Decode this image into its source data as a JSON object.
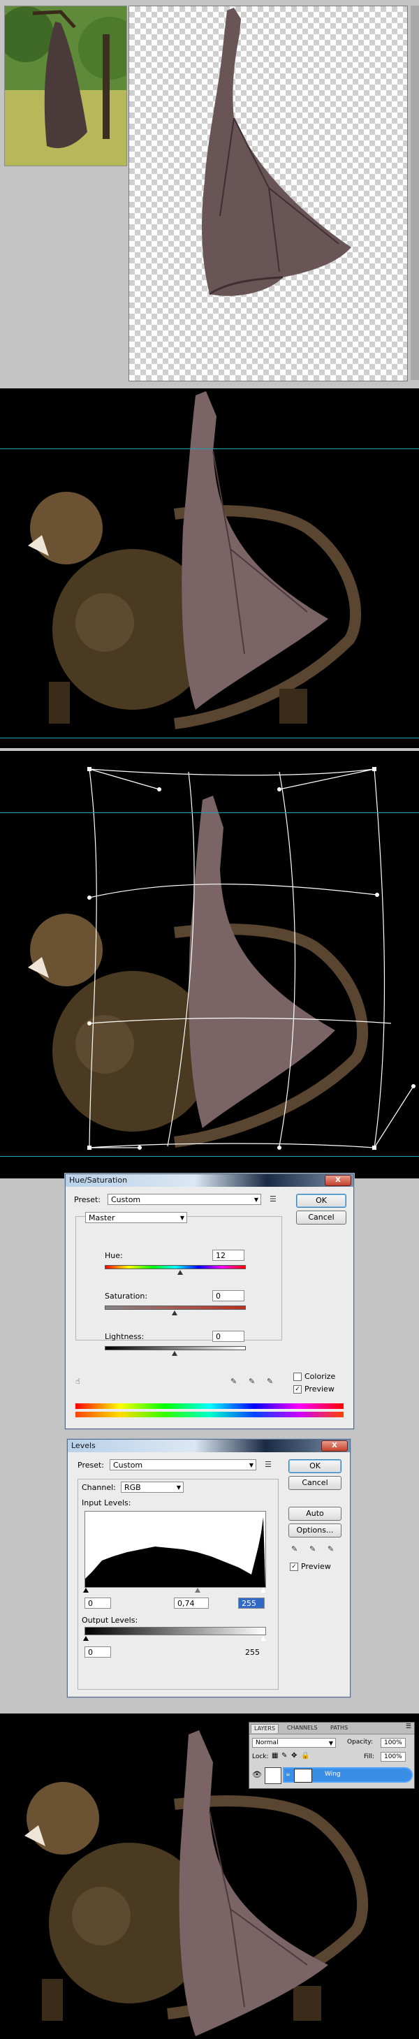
{
  "hue_saturation": {
    "title": "Hue/Saturation",
    "close": "X",
    "preset_label": "Preset:",
    "preset_value": "Custom",
    "channel_value": "Master",
    "hue_label": "Hue:",
    "hue_value": "12",
    "saturation_label": "Saturation:",
    "saturation_value": "0",
    "lightness_label": "Lightness:",
    "lightness_value": "0",
    "ok": "OK",
    "cancel": "Cancel",
    "colorize_label": "Colorize",
    "preview_label": "Preview",
    "preview_checked": "✓"
  },
  "levels": {
    "title": "Levels",
    "close": "X",
    "preset_label": "Preset:",
    "preset_value": "Custom",
    "channel_label": "Channel:",
    "channel_value": "RGB",
    "input_levels_label": "Input Levels:",
    "input_black": "0",
    "input_gamma": "0,74",
    "input_white": "255",
    "output_levels_label": "Output Levels:",
    "output_black": "0",
    "output_white": "255",
    "ok": "OK",
    "cancel": "Cancel",
    "auto": "Auto",
    "options": "Options...",
    "preview_label": "Preview",
    "preview_checked": "✓"
  },
  "layers_panel": {
    "tabs": [
      "LAYERS",
      "CHANNELS",
      "PATHS"
    ],
    "blend_mode": "Normal",
    "opacity_label": "Opacity:",
    "opacity_value": "100%",
    "lock_label": "Lock:",
    "fill_label": "Fill:",
    "fill_value": "100%",
    "layer_name": "Wing"
  }
}
